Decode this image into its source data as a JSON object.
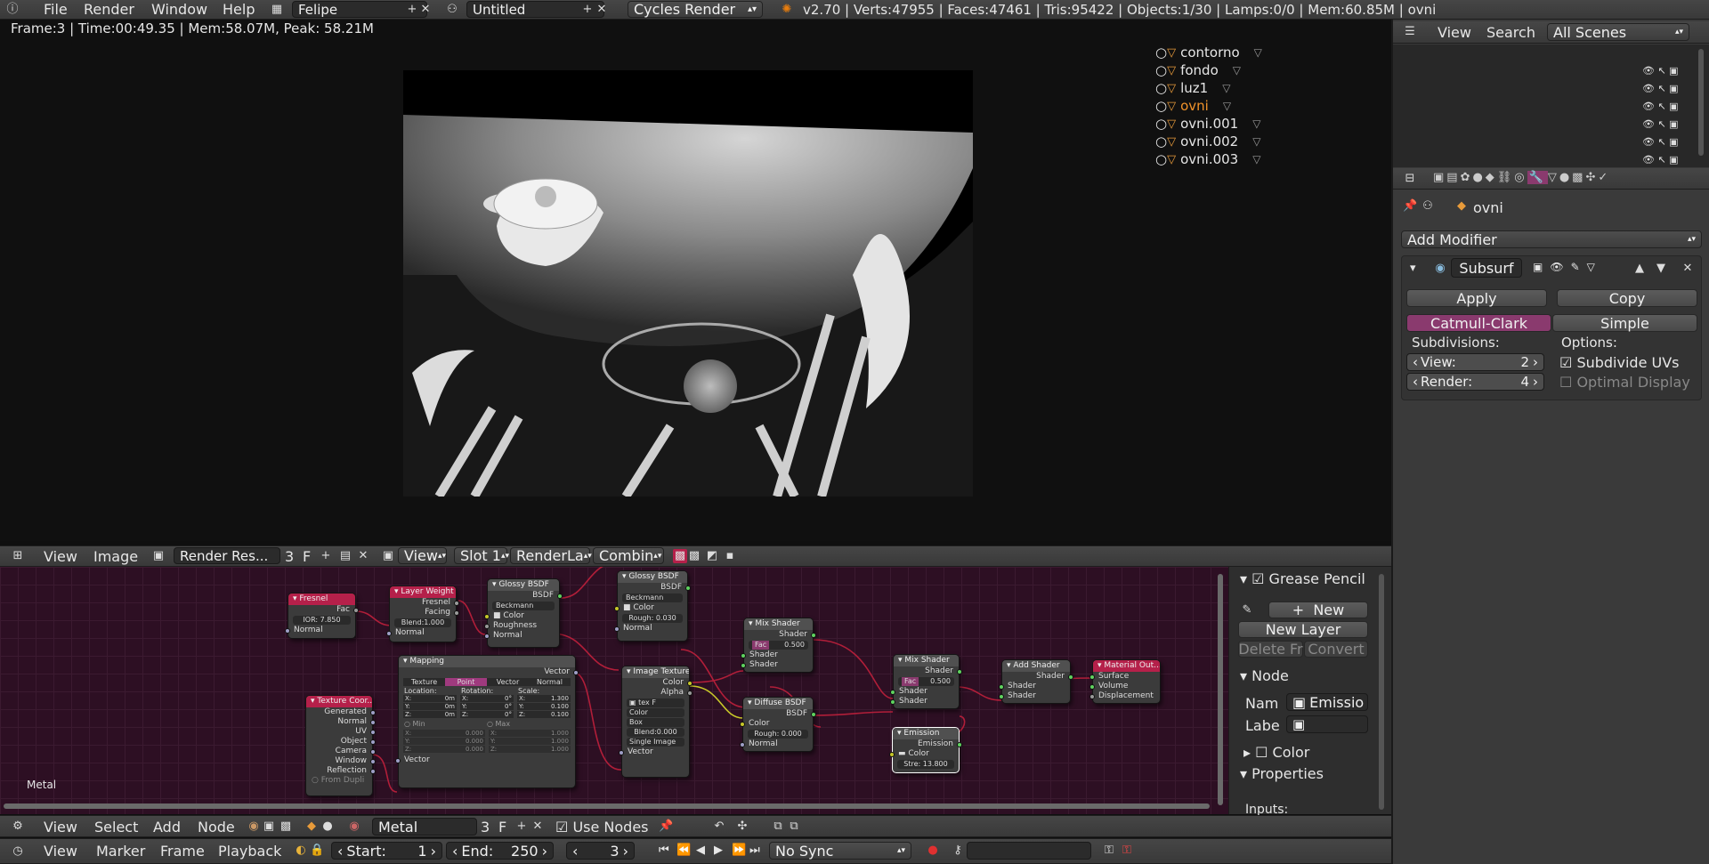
{
  "topbar": {
    "menus": [
      "File",
      "Render",
      "Window",
      "Help"
    ],
    "screen": "Felipe",
    "scene": "Untitled",
    "engine": "Cycles Render",
    "stats": "v2.70 | Verts:47955 | Faces:47461 | Tris:95422 | Objects:1/30 | Lamps:0/0 | Mem:60.85M | ovni"
  },
  "render_info": "Frame:3 | Time:00:49.35 | Mem:58.07M, Peak: 58.21M",
  "image_header": {
    "menus": [
      "View",
      "Image"
    ],
    "image_name": "Render Res...",
    "users": "3",
    "f": "F",
    "view": "View",
    "slot": "Slot 1",
    "layer": "RenderLa",
    "pass": "Combin"
  },
  "outliner": {
    "header": {
      "view": "View",
      "search": "Search",
      "filter": "All Scenes"
    },
    "items": [
      "contorno",
      "fondo",
      "luz1",
      "ovni",
      "ovni.001",
      "ovni.002",
      "ovni.003"
    ],
    "active": "ovni"
  },
  "properties": {
    "object": "ovni",
    "add_modifier": "Add Modifier",
    "modifier": {
      "name": "Subsurf",
      "apply": "Apply",
      "copy": "Copy",
      "type_a": "Catmull-Clark",
      "type_b": "Simple",
      "subdivisions": "Subdivisions:",
      "view_label": "View:",
      "view_val": "2",
      "render_label": "Render:",
      "render_val": "4",
      "options": "Options:",
      "subdivide_uvs": "Subdivide UVs",
      "optimal_display": "Optimal Display"
    }
  },
  "node_panel": {
    "grease": "Grease Pencil",
    "new": "New",
    "new_layer": "New Layer",
    "delete": "Delete Fr",
    "convert": "Convert",
    "node": "Node",
    "name_label": "Nam",
    "name_val": "Emissio",
    "label_label": "Labe",
    "color": "Color",
    "properties": "Properties",
    "inputs": "Inputs:"
  },
  "node_editor": {
    "material_label": "Metal",
    "nodes": {
      "fresnel": {
        "title": "Fresnel",
        "out": "Fac",
        "ior": "IOR: 7.850",
        "normal": "Normal"
      },
      "layer_weight": {
        "title": "Layer Weight",
        "out1": "Fresnel",
        "out2": "Facing",
        "blend": "Blend:1.000",
        "normal": "Normal"
      },
      "glossy1": {
        "title": "Glossy BSDF",
        "out": "BSDF",
        "dist": "Beckmann",
        "color": "Color",
        "rough": "Roughness",
        "normal": "Normal"
      },
      "glossy2": {
        "title": "Glossy BSDF",
        "out": "BSDF",
        "dist": "Beckmann",
        "color": "Color",
        "rough": "Rough: 0.030",
        "normal": "Normal"
      },
      "mapping": {
        "title": "Mapping",
        "out": "Vector",
        "tabs": [
          "Texture",
          "Point",
          "Vector",
          "Normal"
        ],
        "loc": "Location:",
        "rot": "Rotation:",
        "scale": "Scale:",
        "lx": "X:",
        "lxv": "0m",
        "ly": "Y:",
        "lyv": "0m",
        "lz": "Z:",
        "lzv": "0m",
        "rx": "X:",
        "rxv": "0°",
        "ry": "Y:",
        "ryv": "0°",
        "rz": "Z:",
        "rzv": "0°",
        "sx": "X:",
        "sxv": "1.300",
        "sy": "Y:",
        "syv": "0.100",
        "sz": "Z:",
        "szv": "0.100",
        "min": "Min",
        "max": "Max",
        "mnx": "X:",
        "mnxv": "0.000",
        "mny": "Y:",
        "mnyv": "0.000",
        "mnz": "Z:",
        "mnzv": "0.000",
        "mxx": "X:",
        "mxxv": "1.000",
        "mxy": "Y:",
        "mxyv": "1.000",
        "mxz": "Z:",
        "mxzv": "1.000",
        "vector": "Vector"
      },
      "texcoord": {
        "title": "Texture Coor...",
        "outs": [
          "Generated",
          "Normal",
          "UV",
          "Object",
          "Camera",
          "Window",
          "Reflection"
        ],
        "dupli": "From Dupli"
      },
      "imgtex": {
        "title": "Image Texture",
        "out1": "Color",
        "out2": "Alpha",
        "img": "tex",
        "f": "F",
        "color": "Color",
        "proj": "Box",
        "blend": "Blend:0.000",
        "ext": "Single Image",
        "vector": "Vector"
      },
      "mix1": {
        "title": "Mix Shader",
        "out": "Shader",
        "fac": "Fac",
        "facv": "0.500",
        "in1": "Shader",
        "in2": "Shader"
      },
      "diffuse": {
        "title": "Diffuse BSDF",
        "out": "BSDF",
        "color": "Color",
        "rough": "Rough: 0.000",
        "normal": "Normal"
      },
      "mix2": {
        "title": "Mix Shader",
        "out": "Shader",
        "fac": "Fac",
        "facv": "0.500",
        "in1": "Shader",
        "in2": "Shader"
      },
      "emission": {
        "title": "Emission",
        "out": "Emission",
        "color": "Color",
        "strength": "Stre: 13.800"
      },
      "addshader": {
        "title": "Add Shader",
        "out": "Shader",
        "in1": "Shader",
        "in2": "Shader"
      },
      "matout": {
        "title": "Material Out...",
        "in1": "Surface",
        "in2": "Volume",
        "in3": "Displacement"
      }
    }
  },
  "node_header": {
    "menus": [
      "View",
      "Select",
      "Add",
      "Node"
    ],
    "material": "Metal",
    "users": "3",
    "f": "F",
    "use_nodes": "Use Nodes"
  },
  "timeline": {
    "menus": [
      "View",
      "Marker",
      "Frame",
      "Playback"
    ],
    "start_label": "Start:",
    "start": "1",
    "end_label": "End:",
    "end": "250",
    "current": "3",
    "sync": "No Sync"
  }
}
